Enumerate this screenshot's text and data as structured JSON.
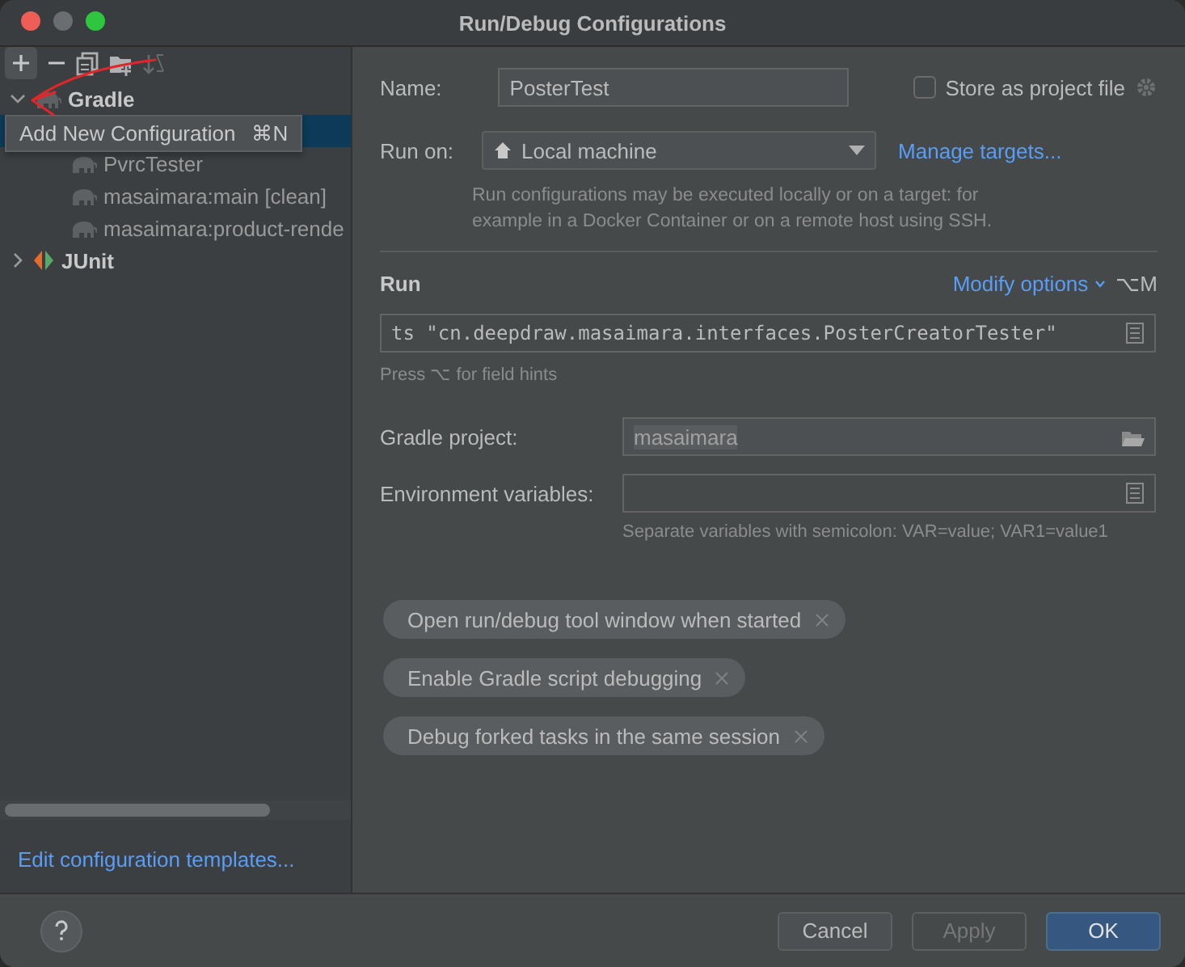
{
  "window": {
    "title": "Run/Debug Configurations"
  },
  "toolbar": {
    "tooltip": {
      "text": "Add New Configuration",
      "shortcut": "⌘N"
    }
  },
  "tree": [
    {
      "label": "Gradle",
      "kind": "gradle",
      "expanded": true,
      "children": [
        {
          "selected": true
        },
        {
          "label": "PvrcTester",
          "selected": false
        },
        {
          "label": "masaimara:main [clean]",
          "selected": false
        },
        {
          "label": "masaimara:product-rende",
          "selected": false
        }
      ]
    },
    {
      "label": "JUnit",
      "kind": "junit",
      "expanded": false
    }
  ],
  "edit_templates_link": "Edit configuration templates...",
  "form": {
    "name_label": "Name:",
    "name_value": "PosterTest",
    "store_as_project_file": {
      "label": "Store as project file",
      "checked": false
    },
    "run_on_label": "Run on:",
    "run_on_value": "Local machine",
    "manage_targets": "Manage targets...",
    "run_on_hint": "Run configurations may be executed locally or on a target: for example in a Docker Container or on a remote host using SSH.",
    "section": "Run",
    "modify_options": "Modify options",
    "modify_shortcut": "⌥M",
    "command": "ts \"cn.deepdraw.masaimara.interfaces.PosterCreatorTester\"",
    "field_hint": "Press ⌥ for field hints",
    "gradle_project_label": "Gradle project:",
    "gradle_project_value": "masaimara",
    "env_label": "Environment variables:",
    "env_hint": "Separate variables with semicolon: VAR=value; VAR1=value1",
    "options": [
      "Open run/debug tool window when started",
      "Enable Gradle script debugging",
      "Debug forked tasks in the same session"
    ]
  },
  "buttons": [
    {
      "label": "Cancel",
      "kind": "normal",
      "disabled": false
    },
    {
      "label": "Apply",
      "kind": "normal",
      "disabled": true
    },
    {
      "label": "OK",
      "kind": "default",
      "disabled": false
    }
  ]
}
